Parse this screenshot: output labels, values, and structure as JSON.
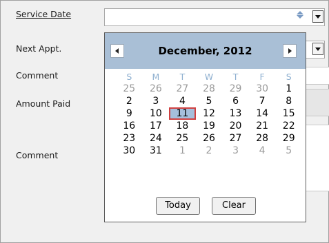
{
  "form": {
    "labels": [
      "Service Date",
      "Next Appt.",
      "Comment",
      "Amount Paid",
      "Comment"
    ]
  },
  "calendar": {
    "month_label": "December, 2012",
    "weekdays": [
      "S",
      "M",
      "T",
      "W",
      "T",
      "F",
      "S"
    ],
    "weeks": [
      [
        [
          "25",
          true
        ],
        [
          "26",
          true
        ],
        [
          "27",
          true
        ],
        [
          "28",
          true
        ],
        [
          "29",
          true
        ],
        [
          "30",
          true
        ],
        [
          "1",
          false
        ]
      ],
      [
        [
          "2",
          false
        ],
        [
          "3",
          false
        ],
        [
          "4",
          false
        ],
        [
          "5",
          false
        ],
        [
          "6",
          false
        ],
        [
          "7",
          false
        ],
        [
          "8",
          false
        ]
      ],
      [
        [
          "9",
          false
        ],
        [
          "10",
          false
        ],
        [
          "11",
          false
        ],
        [
          "12",
          false
        ],
        [
          "13",
          false
        ],
        [
          "14",
          false
        ],
        [
          "15",
          false
        ]
      ],
      [
        [
          "16",
          false
        ],
        [
          "17",
          false
        ],
        [
          "18",
          false
        ],
        [
          "19",
          false
        ],
        [
          "20",
          false
        ],
        [
          "21",
          false
        ],
        [
          "22",
          false
        ]
      ],
      [
        [
          "23",
          false
        ],
        [
          "24",
          false
        ],
        [
          "25",
          false
        ],
        [
          "26",
          false
        ],
        [
          "27",
          false
        ],
        [
          "28",
          false
        ],
        [
          "29",
          false
        ]
      ],
      [
        [
          "30",
          false
        ],
        [
          "31",
          false
        ],
        [
          "1",
          true
        ],
        [
          "2",
          true
        ],
        [
          "3",
          true
        ],
        [
          "4",
          true
        ],
        [
          "5",
          true
        ]
      ]
    ],
    "selected_day": "11",
    "today_label": "Today",
    "clear_label": "Clear",
    "colors": {
      "header": "#a9bfd6",
      "weekday": "#8fb0d0",
      "selected": "#a5bfdc",
      "selected_border": "#d04040"
    }
  }
}
